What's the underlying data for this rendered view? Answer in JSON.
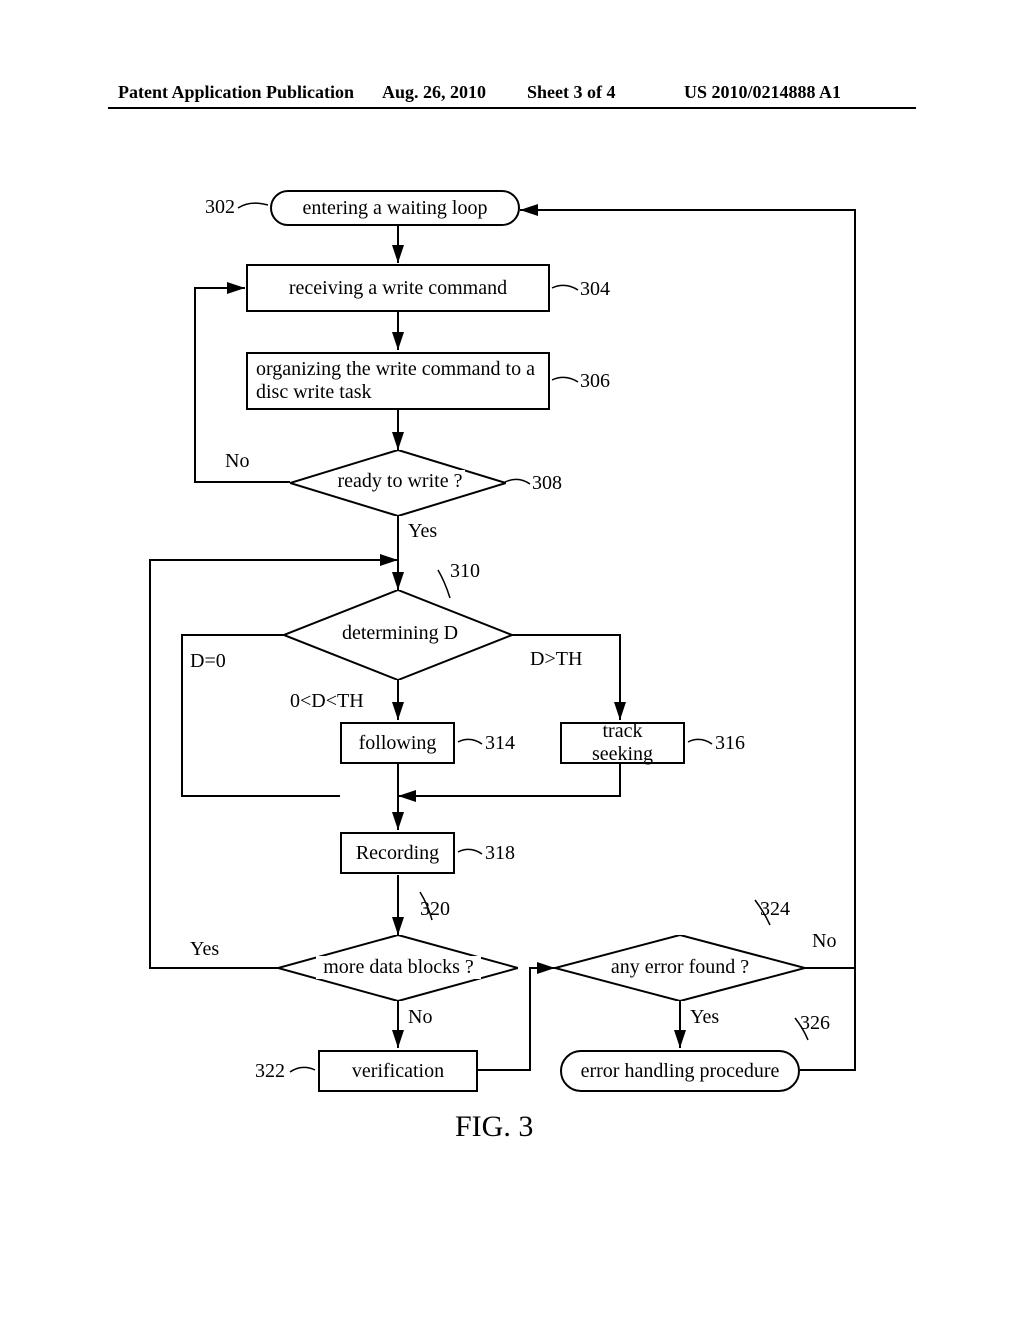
{
  "header": {
    "left": "Patent Application Publication",
    "date": "Aug. 26, 2010",
    "sheet": "Sheet 3 of 4",
    "pubno": "US 2010/0214888 A1"
  },
  "nodes": {
    "n302": {
      "ref": "302",
      "label": "entering a waiting loop"
    },
    "n304": {
      "ref": "304",
      "label": "receiving a write command"
    },
    "n306": {
      "ref": "306",
      "label": "organizing the write command to a disc write task"
    },
    "n308": {
      "ref": "308",
      "label": "ready to write ?"
    },
    "n310": {
      "ref": "310",
      "label": "determining D"
    },
    "n314": {
      "ref": "314",
      "label": "following"
    },
    "n316": {
      "ref": "316",
      "label": "track seeking"
    },
    "n318": {
      "ref": "318",
      "label": "Recording"
    },
    "n320": {
      "ref": "320",
      "label": "more data blocks ?"
    },
    "n322": {
      "ref": "322",
      "label": "verification"
    },
    "n324": {
      "ref": "324",
      "label": "any error found ?"
    },
    "n326": {
      "ref": "326",
      "label": "error handling procedure"
    }
  },
  "edge_labels": {
    "n308_no": "No",
    "n308_yes": "Yes",
    "n310_d0": "D=0",
    "n310_mid": "0<D<TH",
    "n310_high": "D>TH",
    "n320_yes": "Yes",
    "n320_no": "No",
    "n324_yes": "Yes",
    "n324_no": "No"
  },
  "figure_caption": "FIG. 3",
  "chart_data": {
    "type": "flowchart",
    "nodes": [
      {
        "id": "302",
        "shape": "terminator",
        "label": "entering a waiting loop"
      },
      {
        "id": "304",
        "shape": "process",
        "label": "receiving a write command"
      },
      {
        "id": "306",
        "shape": "process",
        "label": "organizing the write command to a disc write task"
      },
      {
        "id": "308",
        "shape": "decision",
        "label": "ready to write ?"
      },
      {
        "id": "310",
        "shape": "decision",
        "label": "determining D"
      },
      {
        "id": "314",
        "shape": "process",
        "label": "following"
      },
      {
        "id": "316",
        "shape": "process",
        "label": "track seeking"
      },
      {
        "id": "318",
        "shape": "process",
        "label": "Recording"
      },
      {
        "id": "320",
        "shape": "decision",
        "label": "more data blocks ?"
      },
      {
        "id": "322",
        "shape": "process",
        "label": "verification"
      },
      {
        "id": "324",
        "shape": "decision",
        "label": "any error found ?"
      },
      {
        "id": "326",
        "shape": "terminator",
        "label": "error handling procedure"
      }
    ],
    "edges": [
      {
        "from": "302",
        "to": "304"
      },
      {
        "from": "304",
        "to": "306"
      },
      {
        "from": "306",
        "to": "308"
      },
      {
        "from": "308",
        "to": "304",
        "label": "No"
      },
      {
        "from": "308",
        "to": "310",
        "label": "Yes"
      },
      {
        "from": "310",
        "to": "318",
        "label": "D=0"
      },
      {
        "from": "310",
        "to": "314",
        "label": "0<D<TH"
      },
      {
        "from": "310",
        "to": "316",
        "label": "D>TH"
      },
      {
        "from": "314",
        "to": "318"
      },
      {
        "from": "316",
        "to": "318"
      },
      {
        "from": "318",
        "to": "320"
      },
      {
        "from": "320",
        "to": "310",
        "label": "Yes"
      },
      {
        "from": "320",
        "to": "322",
        "label": "No"
      },
      {
        "from": "322",
        "to": "324"
      },
      {
        "from": "324",
        "to": "326",
        "label": "Yes"
      },
      {
        "from": "324",
        "to": "302",
        "label": "No"
      },
      {
        "from": "326",
        "to": "302"
      }
    ]
  }
}
